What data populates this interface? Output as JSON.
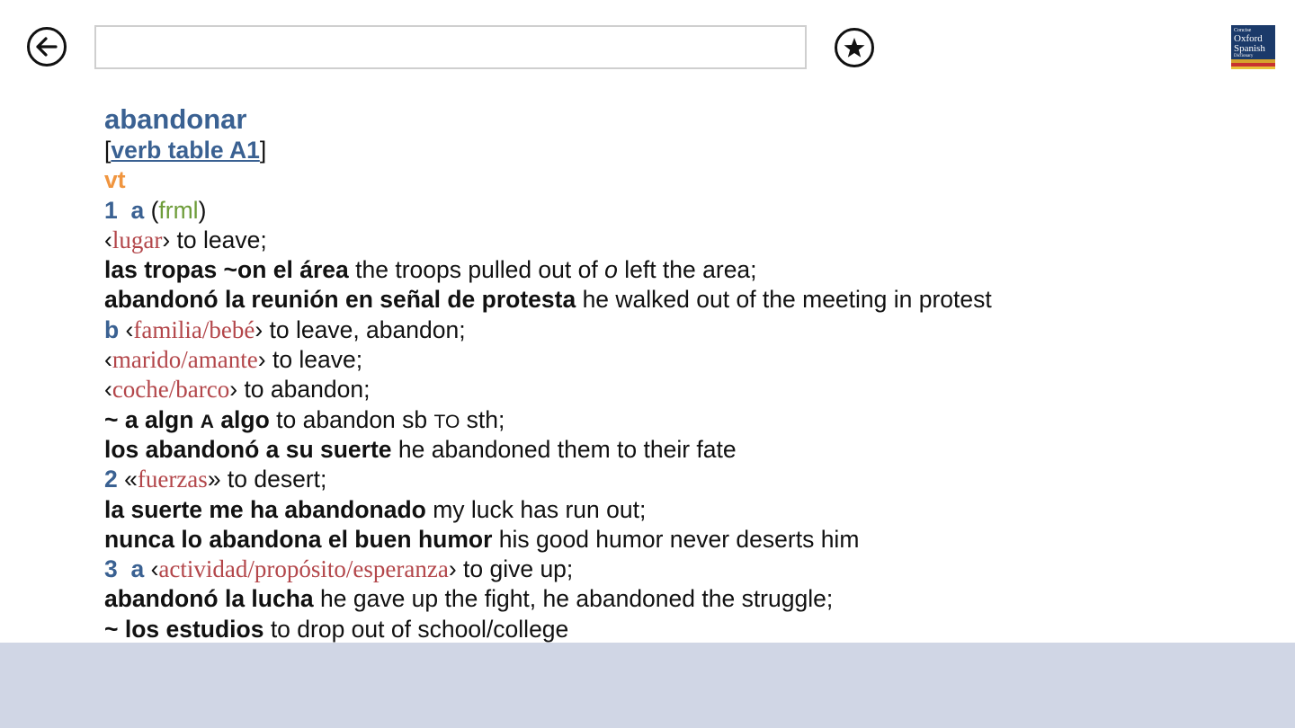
{
  "toolbar": {
    "search_value": "",
    "search_placeholder": "",
    "back_icon": "arrow-left-circle-icon",
    "favorite_icon": "star-circle-icon",
    "logo": {
      "line1": "Concise",
      "line2": "Oxford",
      "line3": "Spanish",
      "line4": "Dictionary"
    }
  },
  "entry": {
    "headword": "abandonar",
    "verb_table_label": "verb table A1",
    "pos": "vt",
    "s1_num": "1",
    "s1_sub": "a",
    "s1_register": "frml",
    "s1_ind1": "lugar",
    "s1_tr1": " to leave;",
    "ex1_es": "las tropas ~on el área",
    "ex1_en_a": " the troops pulled out of ",
    "ex1_en_o": "o",
    "ex1_en_b": " left the area;",
    "ex2_es": "abandonó la reunión en señal de protesta",
    "ex2_en": " he walked out of the meeting in protest",
    "s1b_sub": "b",
    "s1b_ind1": "familia/bebé",
    "s1b_tr1": " to leave, abandon;",
    "s1b_ind2": "marido/amante",
    "s1b_tr2": " to leave;",
    "s1b_ind3": "coche/barco",
    "s1b_tr3": " to abandon;",
    "s1b_cons_a": "~ a algn ",
    "s1b_cons_A": "A",
    "s1b_cons_b": " algo",
    "s1b_cons_tr_a": " to abandon sb ",
    "s1b_cons_TO": "TO",
    "s1b_cons_tr_b": " sth;",
    "ex3_es": "los abandonó a su suerte",
    "ex3_en": " he abandoned them to their fate",
    "s2_num": "2",
    "s2_ind": "fuerzas",
    "s2_tr": " to desert;",
    "ex4_es": "la suerte me ha abandonado",
    "ex4_en": " my luck has run out;",
    "ex5_es": "nunca lo abandona el buen humor",
    "ex5_en": " his good humor never deserts him",
    "s3_num": "3",
    "s3_sub": "a",
    "s3_ind": "actividad/propósito/esperanza",
    "s3_tr": " to give up;",
    "ex6_es": "abandonó la lucha",
    "ex6_en": " he gave up the fight, he abandoned the struggle;",
    "ex7_es": "~ los estudios",
    "ex7_en": " to drop out of school/college"
  },
  "colors": {
    "headword": "#3a6192",
    "pos": "#f0953f",
    "register": "#6e9d3a",
    "indicator": "#b3464a",
    "bottom_bar": "#d0d6e5"
  }
}
